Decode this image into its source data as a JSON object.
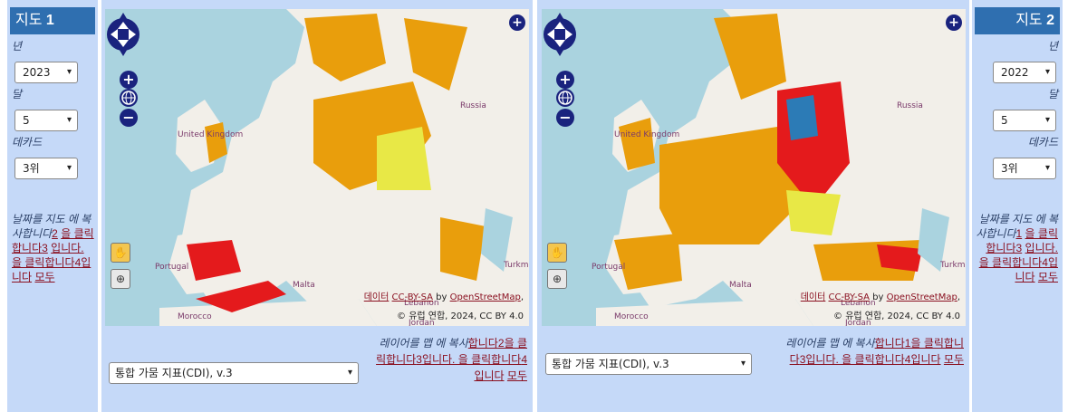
{
  "colors": {
    "panel_bg": "#c5d9f8",
    "header_bg": "#2f6fb0",
    "sea": "#aad3df",
    "land": "#f2efe9",
    "no_data": "#ffffff",
    "watch": "#e8e846",
    "warning": "#e99e0c",
    "alert": "#e41a1c",
    "recovery": "#2c7bb6",
    "control_icons": "#1a237e"
  },
  "map1_panel": {
    "header": {
      "title": "지도",
      "number": "1"
    },
    "year_label": "년",
    "year_value": "2023",
    "month_label": "달",
    "month_value": "5",
    "dekad_label": "데카드",
    "dekad_value": "3위",
    "copy_date_text": "날짜를 지도 에 복사합니다",
    "copy_date_links": [
      "2",
      "을 클릭합니다",
      "3",
      "입니다. 을 클릭합니다",
      "4",
      "입니다",
      "모두"
    ]
  },
  "map2_panel": {
    "header": {
      "title": "지도",
      "number": "2"
    },
    "year_label": "년",
    "year_value": "2022",
    "month_label": "달",
    "month_value": "5",
    "dekad_label": "데카드",
    "dekad_value": "3위",
    "copy_date_text": "날짜를 지도 에 복사합니다",
    "copy_date_links": [
      "1",
      "을 클릭합니다",
      "3",
      "입니다. 을 클릭합니다",
      "4",
      "입니다",
      "모두"
    ]
  },
  "map1": {
    "layer_select_value": "통합 가뭄 지표(CDI), v.3",
    "layer_copy_text": "레이어를 맵 에 복사",
    "layer_copy_links": [
      "합니다",
      "2",
      "을 클릭합니다",
      "3",
      "입니다. 을 클릭합니다",
      "4",
      "입니다",
      "모두"
    ],
    "attribution_line1_prefix": "데이터",
    "attribution_line1_link1": "CC-BY-SA",
    "attribution_line1_mid": "by",
    "attribution_line1_link2": "OpenStreetMap",
    "attribution_line2": "© 유럽 연합, 2024, CC BY 4.0",
    "places": [
      "Russia",
      "United Kingdom",
      "Portugal",
      "Malta",
      "Morocco",
      "Lebanon",
      "Jordan",
      "Turkm"
    ]
  },
  "map2": {
    "layer_select_value": "통합 가뭄 지표(CDI), v.3",
    "layer_copy_text": "레이어를 맵 에 복사",
    "layer_copy_links": [
      "합니다",
      "1",
      "을 클릭합니다",
      "3",
      "입니다. 을 클릭합니다",
      "4",
      "입니다",
      "모두"
    ],
    "attribution_line1_prefix": "데이터",
    "attribution_line1_link1": "CC-BY-SA",
    "attribution_line1_mid": "by",
    "attribution_line1_link2": "OpenStreetMap",
    "attribution_line2": "© 유럽 연합, 2024, CC BY 4.0",
    "places": [
      "Russia",
      "United Kingdom",
      "Portugal",
      "Malta",
      "Morocco",
      "Lebanon",
      "Jordan",
      "Turkm"
    ]
  },
  "icons": {
    "pan": "pan-arrows-icon",
    "zoom_in": "zoom-in-icon",
    "zoom_out": "zoom-out-icon",
    "globe": "globe-icon",
    "expand": "expand-plus-icon",
    "hand": "hand-pan-icon",
    "zoom_box": "zoom-box-icon"
  }
}
